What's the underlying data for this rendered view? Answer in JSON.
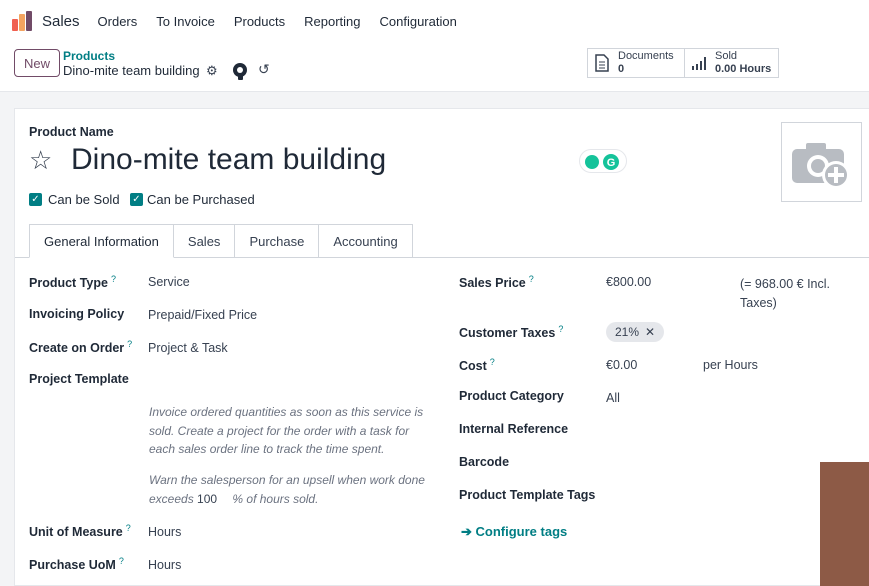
{
  "topbar": {
    "app_name": "Sales",
    "menu": [
      "Orders",
      "To Invoice",
      "Products",
      "Reporting",
      "Configuration"
    ]
  },
  "control": {
    "new_label": "New",
    "breadcrumb_parent": "Products",
    "breadcrumb_current": "Dino-mite team building",
    "documents_label": "Documents",
    "documents_count": "0",
    "sold_label": "Sold",
    "sold_value": "0.00 Hours"
  },
  "form": {
    "name_label": "Product Name",
    "name": "Dino-mite team building",
    "can_be_sold": "Can be Sold",
    "can_be_purchased": "Can be Purchased",
    "tabs": [
      "General Information",
      "Sales",
      "Purchase",
      "Accounting"
    ],
    "left": {
      "product_type_label": "Product Type",
      "product_type": "Service",
      "invoicing_policy_label": "Invoicing Policy",
      "invoicing_policy": "Prepaid/Fixed Price",
      "create_on_order_label": "Create on Order",
      "create_on_order": "Project & Task",
      "project_template_label": "Project Template",
      "help_text_1": "Invoice ordered quantities as soon as this service is sold. Create a project for the order with a task for each sales order line to track the time spent.",
      "help_text_2a": "Warn the salesperson for an upsell when work done",
      "help_text_2b": "exceeds",
      "upsell_value": "100",
      "help_text_2c": "% of hours sold.",
      "uom_label": "Unit of Measure",
      "uom": "Hours",
      "purchase_uom_label": "Purchase UoM",
      "purchase_uom": "Hours"
    },
    "right": {
      "sales_price_label": "Sales Price",
      "sales_price": "€800.00",
      "incl_taxes": "(= 968.00 € Incl. Taxes)",
      "customer_taxes_label": "Customer Taxes",
      "tax_badge": "21%",
      "cost_label": "Cost",
      "cost": "€0.00",
      "cost_unit": "per Hours",
      "category_label": "Product Category",
      "category": "All",
      "internal_ref_label": "Internal Reference",
      "barcode_label": "Barcode",
      "tags_label": "Product Template Tags",
      "configure_tags": "Configure tags"
    },
    "help_mark": "?"
  },
  "colors": {
    "accent": "#017e84",
    "brand": "#714b67"
  }
}
